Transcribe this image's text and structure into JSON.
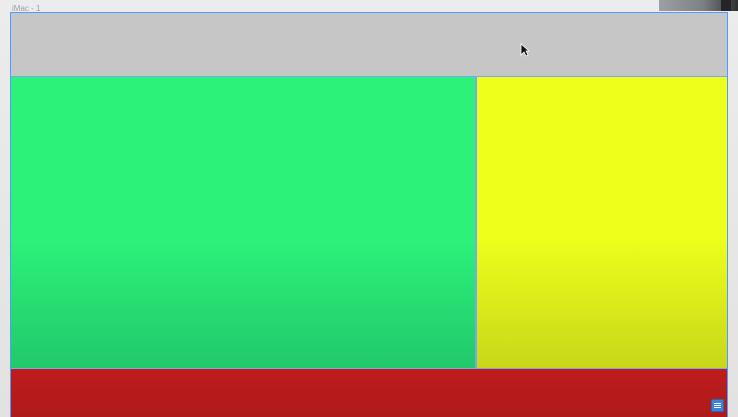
{
  "canvas": {
    "frame_label": "iMac - 1",
    "background_color": "#e7e7e7"
  },
  "artboard": {
    "sections": [
      {
        "name": "header-block",
        "color": "#c6c6c6"
      },
      {
        "name": "main-block",
        "color": "#2df27a"
      },
      {
        "name": "side-block",
        "color": "#edff1b"
      },
      {
        "name": "footer-block",
        "color": "#bf1c1d"
      }
    ]
  },
  "icons": {
    "cursor": "cursor-icon",
    "bottom_right": "list-icon"
  }
}
